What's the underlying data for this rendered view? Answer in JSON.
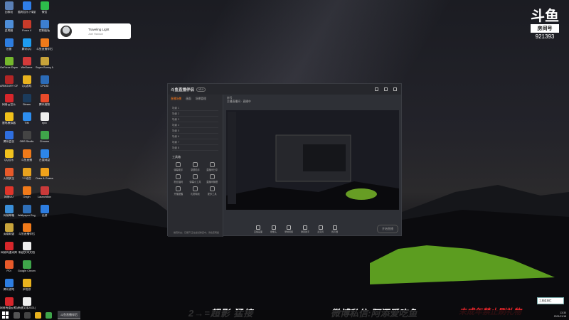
{
  "desktop": {
    "icons": [
      {
        "label": "回收站",
        "color": "#5a7fb5"
      },
      {
        "label": "酷狗音乐下载器",
        "color": "#2f7ee8"
      },
      {
        "label": "微信",
        "color": "#2dbb4b"
      },
      {
        "label": "此电脑",
        "color": "#4e8ed9"
      },
      {
        "label": "Forza 4",
        "color": "#c83b2a"
      },
      {
        "label": "控制面板",
        "color": "#3d7fd1"
      },
      {
        "label": "迅雷",
        "color": "#2d7de0"
      },
      {
        "label": "腾讯QQ",
        "color": "#1e9cf0"
      },
      {
        "label": "斗鱼直播伴侣",
        "color": "#f07a1a"
      },
      {
        "label": "GeForce Experience",
        "color": "#75b82d"
      },
      {
        "label": "WeGame",
        "color": "#d23a3a"
      },
      {
        "label": "Super Bunny Man",
        "color": "#c8a33a"
      },
      {
        "label": "ARMOURY CRATE",
        "color": "#b42525"
      },
      {
        "label": "QQ游戏",
        "color": "#e8b21e"
      },
      {
        "label": "CPUID",
        "color": "#2b6bb8"
      },
      {
        "label": "网易云音乐",
        "color": "#d7262b"
      },
      {
        "label": "Steam",
        "color": "#1b3b5c"
      },
      {
        "label": "腾讯视频",
        "color": "#e94a2a"
      },
      {
        "label": "雷电模拟器",
        "color": "#f0c01a"
      },
      {
        "label": "TIM",
        "color": "#2d8ef0"
      },
      {
        "label": "epic",
        "color": "#eeeeee"
      },
      {
        "label": "腾讯会议",
        "color": "#2f6fe0"
      },
      {
        "label": "OBS Studio",
        "color": "#444444"
      },
      {
        "label": "Chrome",
        "color": "#3fa54a"
      },
      {
        "label": "QQ音乐",
        "color": "#f2c21e"
      },
      {
        "label": "斗鱼直播",
        "color": "#f07a1a"
      },
      {
        "label": "百度网盘",
        "color": "#2d86e8"
      },
      {
        "label": "火绒安全",
        "color": "#e85a2a"
      },
      {
        "label": "YY语音",
        "color": "#e8a21e"
      },
      {
        "label": "Draw & Guess",
        "color": "#f0a21a"
      },
      {
        "label": "网易UU",
        "color": "#e0352a"
      },
      {
        "label": "Origin",
        "color": "#f07a1a"
      },
      {
        "label": "LaunchBox",
        "color": "#c93a3a"
      },
      {
        "label": "网易邮箱",
        "color": "#3a8fd9"
      },
      {
        "label": "Wallpaper Engine",
        "color": "#2f6fb8"
      },
      {
        "label": "迅游",
        "color": "#2d7de0"
      },
      {
        "label": "英雄联盟",
        "color": "#c8a33a"
      },
      {
        "label": "斗鱼直播伴侣",
        "color": "#f07a1a"
      },
      {
        "label": "",
        "color": "rgba(0,0,0,0)"
      },
      {
        "label": "网易有道词典",
        "color": "#d7262b"
      },
      {
        "label": "新建文本文档",
        "color": "#eeeeee"
      },
      {
        "label": "",
        "color": "rgba(0,0,0,0)"
      },
      {
        "label": "PDI",
        "color": "#e85a2a"
      },
      {
        "label": "Google Chrome",
        "color": "#3fa54a"
      },
      {
        "label": "",
        "color": "rgba(0,0,0,0)"
      },
      {
        "label": "腾讯游戏",
        "color": "#2d7de0"
      },
      {
        "label": "米哈游",
        "color": "#e8b21e"
      },
      {
        "label": "",
        "color": "rgba(0,0,0,0)"
      },
      {
        "label": "网易有道云笔记",
        "color": "#d7262b"
      },
      {
        "label": "新建文本2021(0)...",
        "color": "#eeeeee"
      }
    ]
  },
  "notification": {
    "title": "Traveling Light",
    "subtitle": "Joel Hanson"
  },
  "room": {
    "room_label": "房间号",
    "room_number": "921393"
  },
  "app": {
    "title": "斗鱼直播伴侣",
    "version": "V5.0",
    "tabs": [
      "直播场景",
      "画面",
      "场景管理"
    ],
    "scenes": [
      "场景 1",
      "场景 2",
      "场景 3",
      "场景 4",
      "场景 5",
      "场景 6",
      "场景 7",
      "场景 8"
    ],
    "tools_title": "工具箱",
    "tools": [
      "弹幕助手",
      "录屏助手",
      "直播间分享",
      "粉丝福利",
      "弹幕小工具",
      "直播间管理",
      "开播提醒",
      "礼物特效",
      "更多工具"
    ],
    "info_line1": "房号",
    "info_line2": "主播直播间 · 直播中",
    "bottom_buttons": [
      "直播画面",
      "摄像头",
      "录制视频",
      "弹幕助手",
      "麦克风",
      "扬声器"
    ],
    "start_live": "开始直播",
    "status": "推流状态：已断开 正在尝试重连中，请检查网络"
  },
  "banners": {
    "b1": "2→=超影  猛接",
    "b2": "微博私信:阿添爱吃鱼",
    "b3": "未成年禁止刷礼物"
  },
  "taskbar": {
    "app_label": "斗鱼直播伴侣",
    "time": "13:30",
    "date": "2021/11/18",
    "toast": "工具菜单栏"
  }
}
